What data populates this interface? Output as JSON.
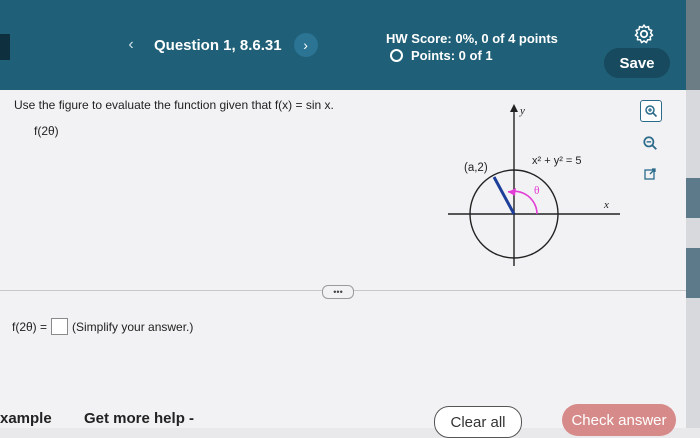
{
  "header": {
    "question_title": "Question 1, 8.6.31",
    "hw_score": "HW Score: 0%, 0 of 4 points",
    "points": "Points: 0 of 1",
    "save_label": "Save"
  },
  "problem": {
    "instruction": "Use the figure to evaluate the function given that f(x) = sin x.",
    "expression": "f(2θ)"
  },
  "figure": {
    "y_label": "y",
    "x_label": "x",
    "point_label": "(a,2)",
    "equation": "x² + y² = 5",
    "angle_label": "θ",
    "colors": {
      "radius": "#1d3f9a",
      "angle_arc": "#e23dd6",
      "axes": "#222222"
    }
  },
  "answer": {
    "prefix": "f(2θ) =",
    "hint": "(Simplify your answer.)"
  },
  "footer": {
    "example_label": "xample",
    "more_help_label": "Get more help -",
    "clear_label": "Clear all",
    "check_label": "Check answer"
  }
}
